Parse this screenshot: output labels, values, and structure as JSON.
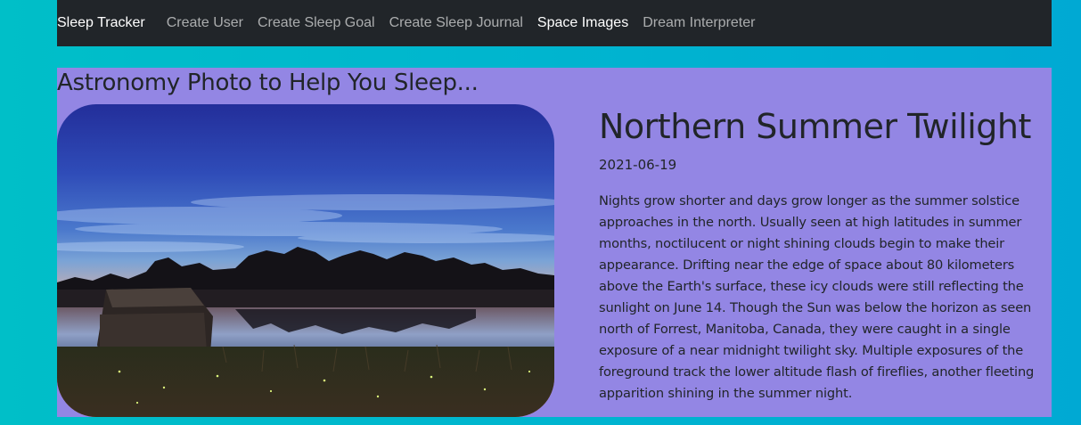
{
  "nav": {
    "brand": "Sleep Tracker",
    "links": [
      {
        "label": "Create User",
        "active": false
      },
      {
        "label": "Create Sleep Goal",
        "active": false
      },
      {
        "label": "Create Sleep Journal",
        "active": false
      },
      {
        "label": "Space Images",
        "active": true
      },
      {
        "label": "Dream Interpreter",
        "active": false
      }
    ]
  },
  "main": {
    "heading": "Astronomy Photo to Help You Sleep...",
    "apod": {
      "title": "Northern Summer Twilight",
      "date": "2021-06-19",
      "explanation": "Nights grow shorter and days grow longer as the summer solstice approaches in the north. Usually seen at high latitudes in summer months, noctilucent or night shining clouds begin to make their appearance. Drifting near the edge of space about 80 kilometers above the Earth's surface, these icy clouds were still reflecting the sunlight on June 14. Though the Sun was below the horizon as seen north of Forrest, Manitoba, Canada, they were caught in a single exposure of a near midnight twilight sky. Multiple exposures of the foreground track the lower altitude flash of fireflies, another fleeting apparition shining in the summer night."
    }
  },
  "colors": {
    "navbar_bg": "#212529",
    "page_bg": "#00b5cf",
    "panel_bg": "#9386e4",
    "text": "#212529"
  }
}
